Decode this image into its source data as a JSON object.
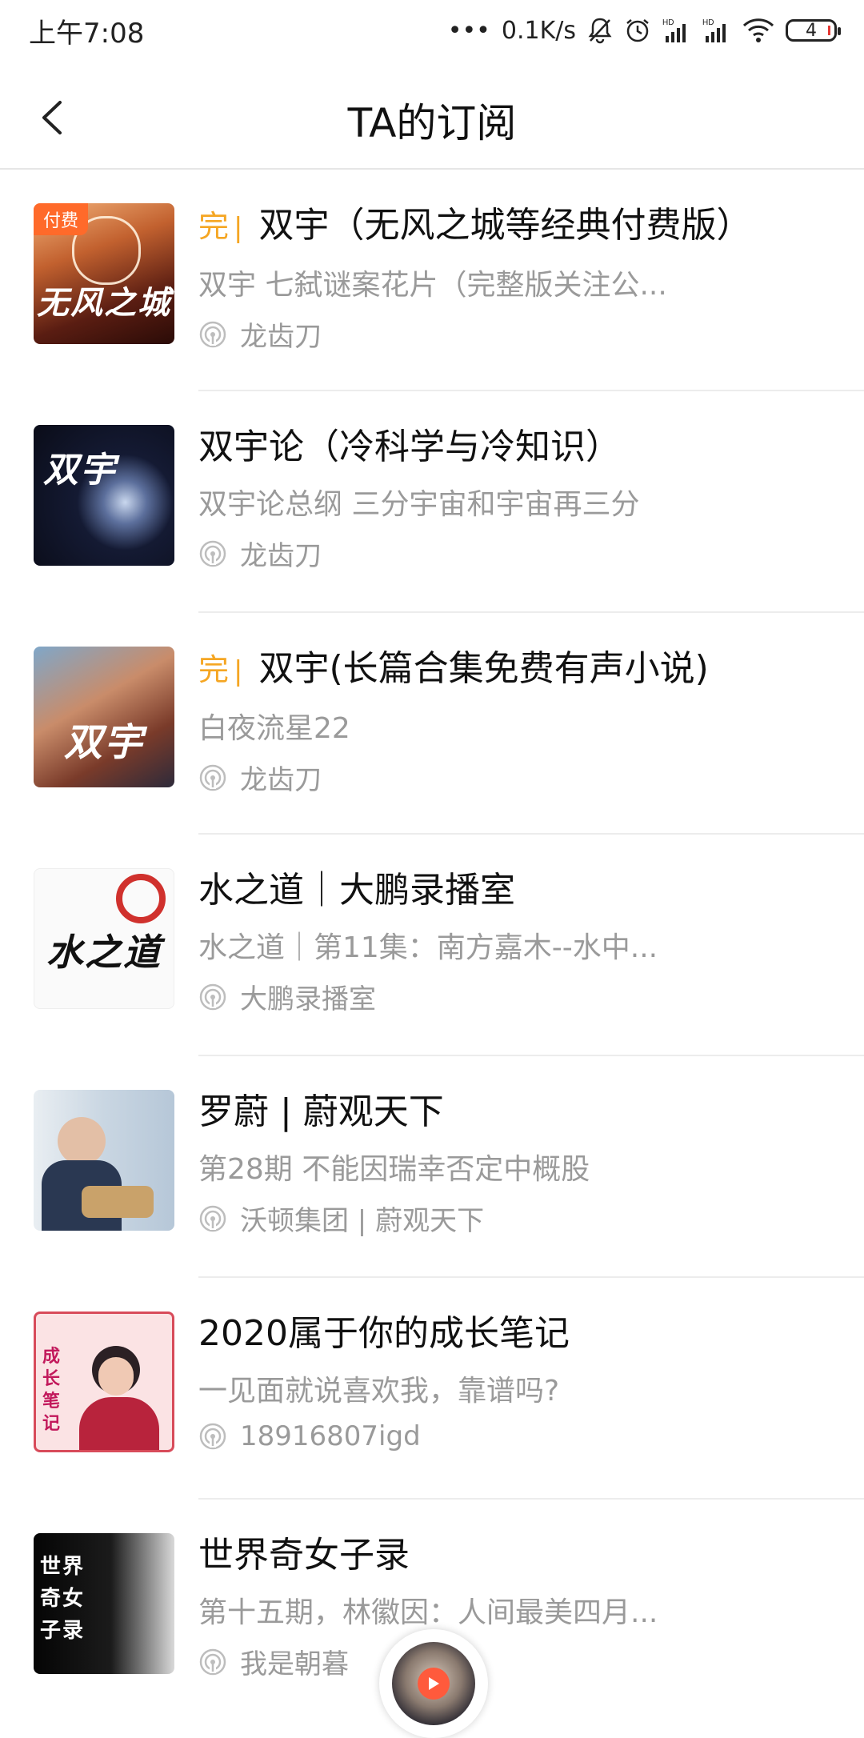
{
  "status_bar": {
    "time": "上午7:08",
    "net_speed": "0.1K/s",
    "battery": "4"
  },
  "header": {
    "title": "TA的订阅"
  },
  "colors": {
    "done_accent": "#f5a623",
    "paid_badge": "#ff6a2a",
    "secondary_text": "#9a9a9a"
  },
  "items": [
    {
      "done": true,
      "done_label": "完",
      "paid_label": "付费",
      "title": "双宇（无风之城等经典付费版）",
      "subtitle": "双宇 七弑谜案花片（完整版关注公...",
      "author": "龙齿刀",
      "cover_text": "无风之城"
    },
    {
      "done": false,
      "title": "双宇论（冷科学与冷知识）",
      "subtitle": "双宇论总纲 三分宇宙和宇宙再三分",
      "author": "龙齿刀",
      "cover_text": "双宇"
    },
    {
      "done": true,
      "done_label": "完",
      "title": "双宇(长篇合集免费有声小说)",
      "subtitle": "白夜流星22",
      "author": "龙齿刀",
      "cover_text": "双宇"
    },
    {
      "done": false,
      "title": "水之道｜大鹏录播室",
      "subtitle": "水之道｜第11集：南方嘉木--水中...",
      "author": "大鹏录播室",
      "cover_text": "水之道"
    },
    {
      "done": false,
      "title": "罗蔚 | 蔚观天下",
      "subtitle": "第28期 不能因瑞幸否定中概股",
      "author": "沃顿集团 | 蔚观天下",
      "cover_text": ""
    },
    {
      "done": false,
      "title": "2020属于你的成长笔记",
      "subtitle": "一见面就说喜欢我，靠谱吗?",
      "author": "18916807igd",
      "cover_text": "成长笔记"
    },
    {
      "done": false,
      "title": "世界奇女子录",
      "subtitle": "第十五期，林徽因：人间最美四月...",
      "author": "我是朝暮",
      "cover_text": "世界奇女子录"
    }
  ]
}
